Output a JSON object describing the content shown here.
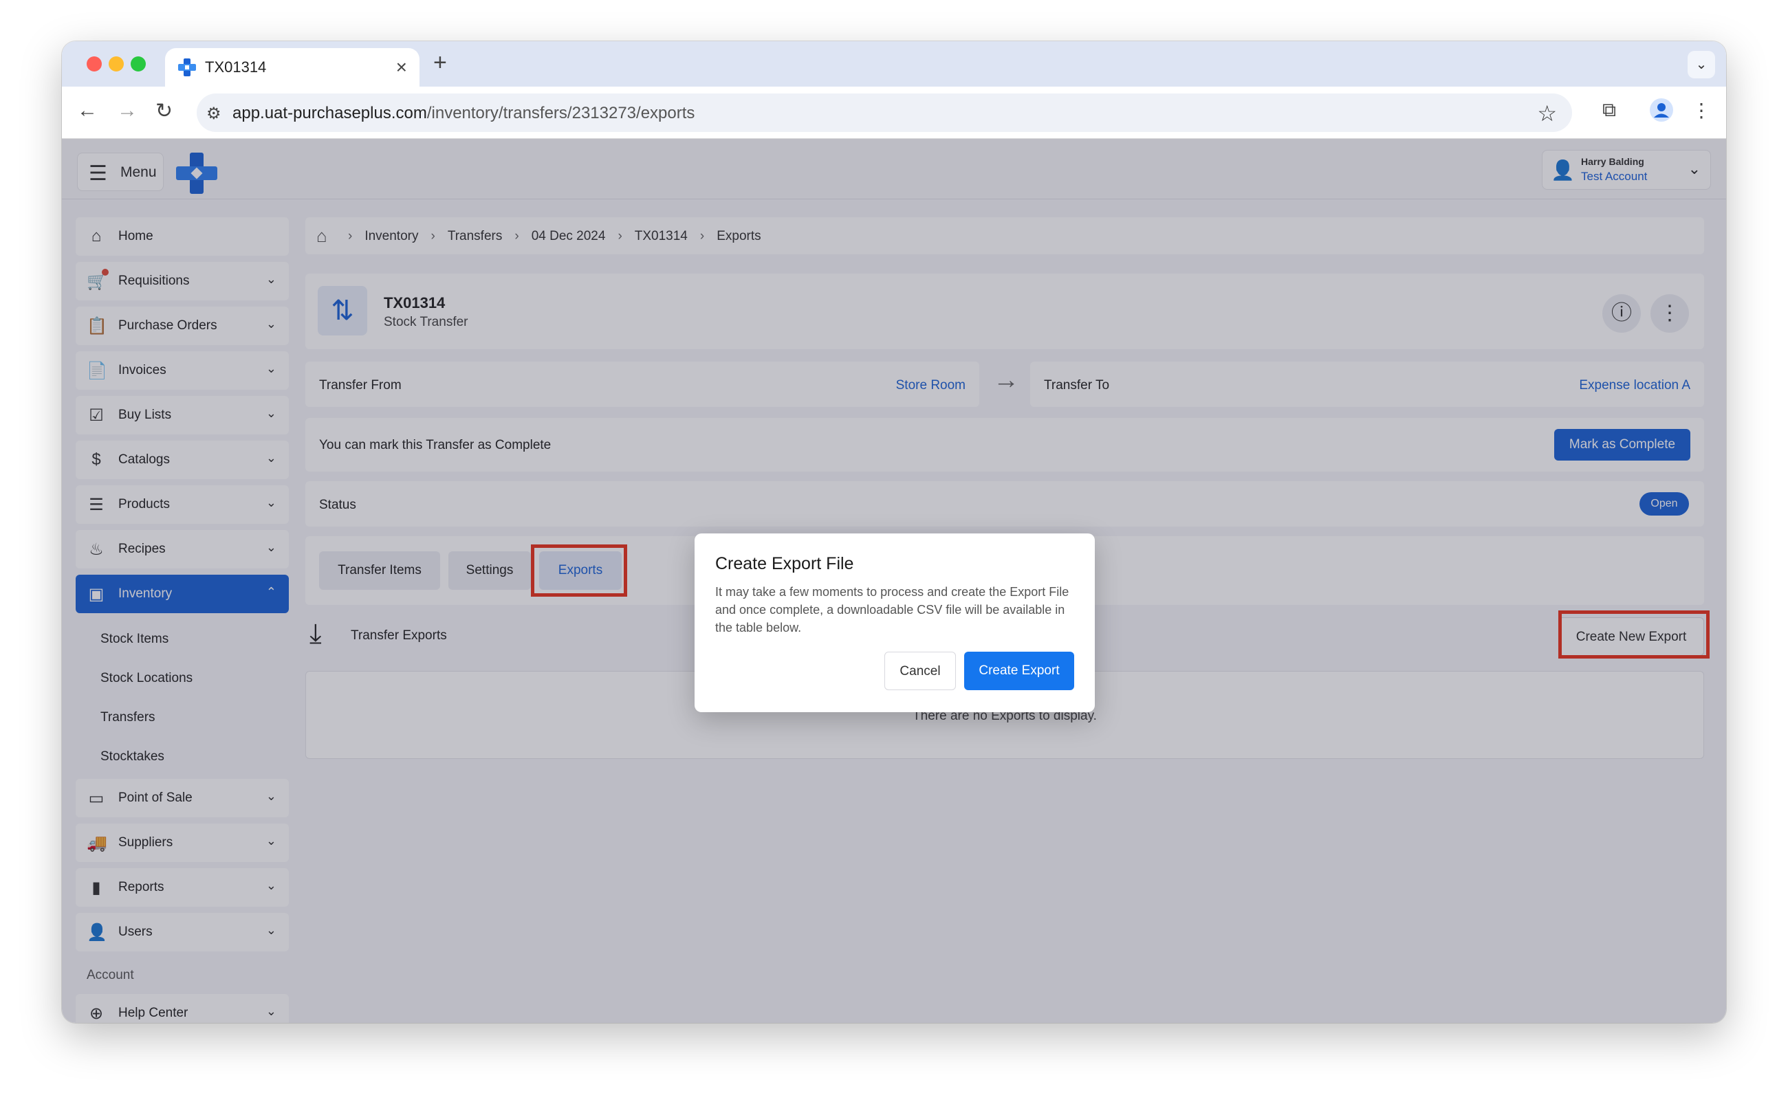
{
  "browser": {
    "tab_title": "TX01314",
    "tab_close": "×",
    "new_tab": "+",
    "url_host": "app.uat-purchaseplus.com",
    "url_path": "/inventory/transfers/2313273/exports"
  },
  "topbar": {
    "menu_label": "Menu",
    "user_name": "Harry Balding",
    "user_account": "Test Account"
  },
  "sidebar": {
    "items": [
      {
        "label": "Home",
        "icon": "home-icon"
      },
      {
        "label": "Requisitions",
        "icon": "cart-icon"
      },
      {
        "label": "Purchase Orders",
        "icon": "clipboard-icon"
      },
      {
        "label": "Invoices",
        "icon": "document-icon"
      },
      {
        "label": "Buy Lists",
        "icon": "checklist-icon"
      },
      {
        "label": "Catalogs",
        "icon": "dollar-doc-icon"
      },
      {
        "label": "Products",
        "icon": "stack-icon"
      },
      {
        "label": "Recipes",
        "icon": "cooking-pot-icon"
      },
      {
        "label": "Inventory",
        "icon": "boxes-icon"
      }
    ],
    "inventory_sub": [
      "Stock Items",
      "Stock Locations",
      "Transfers",
      "Stocktakes"
    ],
    "items_after": [
      {
        "label": "Point of Sale",
        "icon": "credit-card-icon"
      },
      {
        "label": "Suppliers",
        "icon": "truck-icon"
      },
      {
        "label": "Reports",
        "icon": "bar-chart-icon"
      },
      {
        "label": "Users",
        "icon": "user-icon"
      }
    ],
    "account_section": "Account",
    "help_center": "Help Center"
  },
  "breadcrumb": [
    "Inventory",
    "Transfers",
    "04 Dec 2024",
    "TX01314",
    "Exports"
  ],
  "header": {
    "title": "TX01314",
    "subtitle": "Stock Transfer"
  },
  "transfer": {
    "from_label": "Transfer From",
    "from_value": "Store Room",
    "to_label": "Transfer To",
    "to_value": "Expense location A"
  },
  "complete_row": {
    "text": "You can mark this Transfer as Complete",
    "button": "Mark as Complete"
  },
  "status_row": {
    "label": "Status",
    "value": "Open"
  },
  "tabs": [
    "Transfer Items",
    "Settings",
    "Exports"
  ],
  "exports": {
    "title": "Transfer Exports",
    "new_button": "Create New Export",
    "empty": "There are no Exports to display."
  },
  "modal": {
    "title": "Create Export File",
    "body": "It may take a few moments to process and create the Export File and once complete, a downloadable CSV file will be available in the table below.",
    "cancel": "Cancel",
    "confirm": "Create Export"
  },
  "colors": {
    "brand": "#1b62d4",
    "highlight": "#e8331c",
    "confirm_button": "#1576ee"
  }
}
